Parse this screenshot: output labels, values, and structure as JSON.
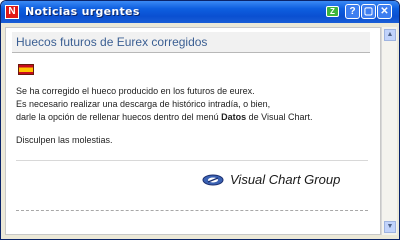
{
  "window": {
    "title": "Noticias urgentes",
    "app_icon_letter": "N",
    "extra_button_label": "Z",
    "help_label": "?",
    "minimize_label": "▢",
    "close_label": "✕"
  },
  "notice": {
    "heading": "Huecos futuros de Eurex corregidos",
    "flag_icon": "spain-flag-icon",
    "line1": "Se ha corregido el hueco producido en los futuros de eurex.",
    "line2": "Es necesario realizar una descarga de histórico intradía, o bien,",
    "line3_prefix": "darle la opción de rellenar huecos dentro del menú ",
    "line3_bold": "Datos",
    "line3_suffix": " de Visual Chart.",
    "apology": "Disculpen las molestias."
  },
  "brand": {
    "logo_text": "Visual Chart Group",
    "logo_icon": "visual-chart-logo-icon"
  },
  "scrollbar": {
    "up_label": "▲",
    "down_label": "▼"
  }
}
